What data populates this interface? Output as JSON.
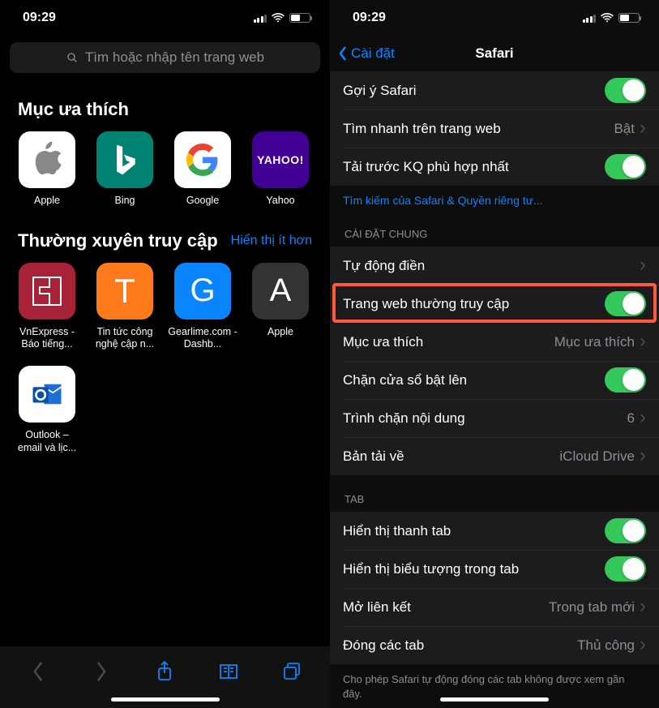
{
  "left": {
    "statusTime": "09:29",
    "searchPlaceholder": "Tìm hoặc nhập tên trang web",
    "favTitle": "Mục ưa thích",
    "favorites": [
      {
        "label": "Apple"
      },
      {
        "label": "Bing"
      },
      {
        "label": "Google"
      },
      {
        "label": "Yahoo"
      }
    ],
    "freqHeader": "Thường xuyên truy cập",
    "freqActionLabel": "Hiển thị ít hơn",
    "frequent": [
      {
        "label": "VnExpress - Báo tiếng..."
      },
      {
        "label": "Tin tức công nghệ cập n..."
      },
      {
        "label": "Gearlime.com - Dashb..."
      },
      {
        "label": "Apple"
      },
      {
        "label": "Outlook – email và lịc..."
      }
    ],
    "yahooText": "YAHOO!",
    "tLetter": "T",
    "gLetter": "G",
    "aLetter": "A"
  },
  "right": {
    "statusTime": "09:29",
    "backLabel": "Cài đặt",
    "title": "Safari",
    "rows1": [
      {
        "label": "Gợi ý Safari",
        "type": "toggle",
        "on": true
      },
      {
        "label": "Tìm nhanh trên trang web",
        "type": "link",
        "value": "Bật"
      },
      {
        "label": "Tải trước KQ phù hợp nhất",
        "type": "toggle",
        "on": true
      }
    ],
    "footerLink1": "Tìm kiếm của Safari & Quyền riêng tư...",
    "header2": "CÀI ĐẶT CHUNG",
    "rows2": [
      {
        "label": "Tự động điền",
        "type": "link"
      },
      {
        "label": "Trang web thường truy cập",
        "type": "toggle",
        "on": true,
        "highlight": true
      },
      {
        "label": "Mục ưa thích",
        "type": "link",
        "value": "Mục ưa thích"
      },
      {
        "label": "Chặn cửa sổ bật lên",
        "type": "toggle",
        "on": true
      },
      {
        "label": "Trình chặn nội dung",
        "type": "link",
        "value": "6"
      },
      {
        "label": "Bản tải về",
        "type": "link",
        "value": "iCloud Drive"
      }
    ],
    "header3": "TAB",
    "rows3": [
      {
        "label": "Hiển thị thanh tab",
        "type": "toggle",
        "on": true
      },
      {
        "label": "Hiển thị biểu tượng trong tab",
        "type": "toggle",
        "on": true
      },
      {
        "label": "Mở liên kết",
        "type": "link",
        "value": "Trong tab mới"
      },
      {
        "label": "Đóng các tab",
        "type": "link",
        "value": "Thủ công"
      }
    ],
    "footerNote": "Cho phép Safari tự động đóng các tab không được xem gần đây."
  }
}
